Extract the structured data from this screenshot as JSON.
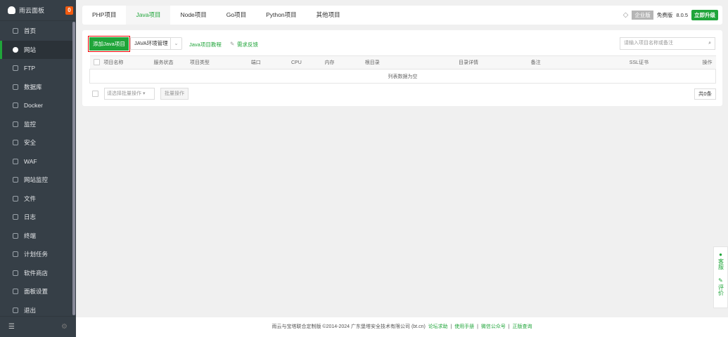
{
  "sidebar": {
    "title": "雨云面板",
    "badge": "0",
    "items": [
      {
        "label": "首页"
      },
      {
        "label": "网站"
      },
      {
        "label": "FTP"
      },
      {
        "label": "数据库"
      },
      {
        "label": "Docker"
      },
      {
        "label": "监控"
      },
      {
        "label": "安全"
      },
      {
        "label": "WAF"
      },
      {
        "label": "网站监控"
      },
      {
        "label": "文件"
      },
      {
        "label": "日志"
      },
      {
        "label": "终端"
      },
      {
        "label": "计划任务"
      },
      {
        "label": "软件商店"
      },
      {
        "label": "面板设置"
      },
      {
        "label": "退出"
      }
    ]
  },
  "tabs": [
    "PHP项目",
    "Java项目",
    "Node项目",
    "Go项目",
    "Python项目",
    "其他项目"
  ],
  "header": {
    "enterprise": "企业版",
    "free": "免费版",
    "version": "8.0.5",
    "upgrade": "立即升级"
  },
  "toolbar": {
    "add": "添加Java项目",
    "env": "JAVA环境管理",
    "tutorial": "Java项目教程",
    "feedback": "需求反馈",
    "search_placeholder": "请输入项目名称或备注"
  },
  "table": {
    "columns": [
      "项目名称",
      "服务状态",
      "项目类型",
      "端口",
      "CPU",
      "内存",
      "根目录",
      "目录详情",
      "备注",
      "SSL证书",
      "操作"
    ],
    "empty": "列表数据为空"
  },
  "batch": {
    "select": "请选择批量操作",
    "button": "批量操作",
    "total": "共0条"
  },
  "float": {
    "service": "客服",
    "review": "评价"
  },
  "footer": {
    "text": "雨云与宝塔联合定制版 ©2014-2024 广东堡塔安全技术有限公司 (bt.cn)",
    "links": [
      "论坛求助",
      "使用手册",
      "微信公众号",
      "正版查询"
    ]
  }
}
